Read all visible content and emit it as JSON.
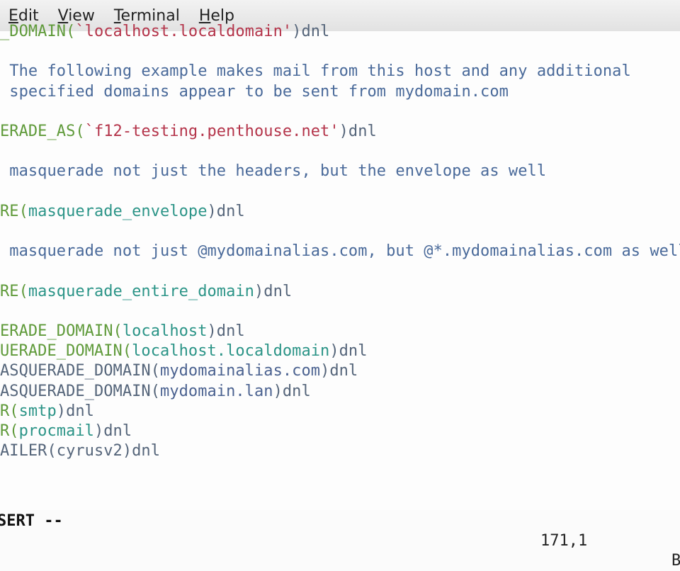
{
  "menu": [
    {
      "mnemonic": "E",
      "rest": "dit"
    },
    {
      "mnemonic": "V",
      "rest": "iew"
    },
    {
      "mnemonic": "T",
      "rest": "erminal"
    },
    {
      "mnemonic": "H",
      "rest": "elp"
    }
  ],
  "colors": {
    "macro": "#5f9a3a",
    "string": "#b4344a",
    "arg": "#2b9487",
    "comment": "#4a6a9a",
    "dnl": "#55657a",
    "alias": "#4b6290"
  },
  "lines": [
    {
      "row": 0,
      "segments": [
        {
          "text": "_DOMAIN(",
          "c": "macro"
        },
        {
          "text": "`localhost.localdomain'",
          "c": "string"
        },
        {
          "text": ")dnl",
          "c": "dnl"
        }
      ]
    },
    {
      "row": 2,
      "segments": [
        {
          "text": " The following example makes mail from this host and any additional",
          "c": "comment"
        }
      ]
    },
    {
      "row": 3,
      "segments": [
        {
          "text": " specified domains appear to be sent from mydomain.com",
          "c": "comment"
        }
      ]
    },
    {
      "row": 5,
      "segments": [
        {
          "text": "ERADE_AS(",
          "c": "macro"
        },
        {
          "text": "`f12-testing.penthouse.net'",
          "c": "string"
        },
        {
          "text": ")dnl",
          "c": "dnl"
        }
      ]
    },
    {
      "row": 7,
      "segments": [
        {
          "text": " masquerade not just the headers, but the envelope as well",
          "c": "comment"
        }
      ]
    },
    {
      "row": 9,
      "segments": [
        {
          "text": "RE(",
          "c": "macro"
        },
        {
          "text": "masquerade_envelope",
          "c": "arg"
        },
        {
          "text": ")dnl",
          "c": "dnl"
        }
      ]
    },
    {
      "row": 11,
      "segments": [
        {
          "text": " masquerade not just @mydomainalias.com, but @*.mydomainalias.com as well",
          "c": "comment"
        }
      ]
    },
    {
      "row": 13,
      "segments": [
        {
          "text": "RE(",
          "c": "macro"
        },
        {
          "text": "masquerade_entire_domain",
          "c": "arg"
        },
        {
          "text": ")dnl",
          "c": "dnl"
        }
      ]
    },
    {
      "row": 15,
      "segments": [
        {
          "text": "ERADE_DOMAIN(",
          "c": "macro"
        },
        {
          "text": "localhost",
          "c": "arg"
        },
        {
          "text": ")dnl",
          "c": "dnl"
        }
      ]
    },
    {
      "row": 16,
      "segments": [
        {
          "text": "UERADE_DOMAIN(",
          "c": "macro"
        },
        {
          "text": "localhost.localdomain",
          "c": "arg"
        },
        {
          "text": ")dnl",
          "c": "dnl"
        }
      ]
    },
    {
      "row": 17,
      "segments": [
        {
          "text": "ASQUERADE_DOMAIN(",
          "c": "dnl"
        },
        {
          "text": "mydomainalias.com",
          "c": "alias"
        },
        {
          "text": ")dnl",
          "c": "dnl"
        }
      ]
    },
    {
      "row": 18,
      "segments": [
        {
          "text": "ASQUERADE_DOMAIN(",
          "c": "dnl"
        },
        {
          "text": "mydomain.lan",
          "c": "alias"
        },
        {
          "text": ")dnl",
          "c": "dnl"
        }
      ]
    },
    {
      "row": 19,
      "segments": [
        {
          "text": "R(",
          "c": "macro"
        },
        {
          "text": "smtp",
          "c": "arg"
        },
        {
          "text": ")dnl",
          "c": "dnl"
        }
      ]
    },
    {
      "row": 20,
      "segments": [
        {
          "text": "R(",
          "c": "macro"
        },
        {
          "text": "procmail",
          "c": "arg"
        },
        {
          "text": ")dnl",
          "c": "dnl"
        }
      ]
    },
    {
      "row": 21,
      "segments": [
        {
          "text": "AILER(cyrusv2)dnl",
          "c": "dnl"
        }
      ]
    }
  ],
  "status": {
    "mode": "SERT --",
    "position": "171,1",
    "scroll": "B"
  }
}
